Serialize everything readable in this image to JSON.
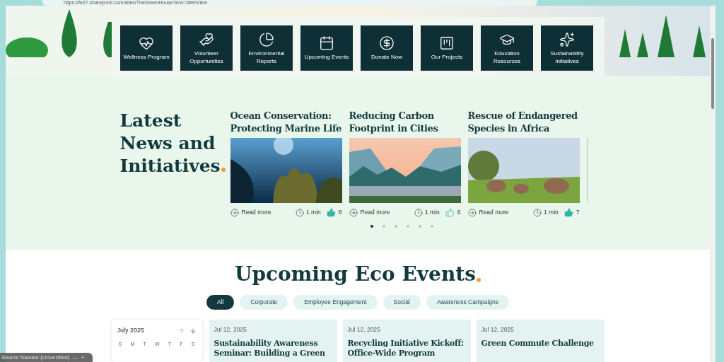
{
  "browser": {
    "url": "https://fe27.sharepoint.com/sites/TheGreenHouse?env=WebView"
  },
  "quick_links": [
    {
      "label": "Wellness Program"
    },
    {
      "label": "Volunteer Opportunities"
    },
    {
      "label": "Environmental Reports"
    },
    {
      "label": "Upcoming Events"
    },
    {
      "label": "Donate Now"
    },
    {
      "label": "Our Projects"
    },
    {
      "label": "Education Resources"
    },
    {
      "label": "Sustainability Initiatives"
    }
  ],
  "news": {
    "title": "Latest News and Initiatives",
    "articles": [
      {
        "title": "Ocean Conservation: Protecting Marine Life",
        "read_more": "Read more",
        "time": "1 min",
        "likes": "8",
        "liked": true
      },
      {
        "title": "Reducing Carbon Footprint in Cities",
        "read_more": "Read more",
        "time": "1 min",
        "likes": "6",
        "liked": false
      },
      {
        "title": "Rescue of Endangered Species in Africa",
        "read_more": "Read more",
        "time": "1 min",
        "likes": "7",
        "liked": true
      }
    ],
    "pages": [
      {
        "selected": true
      },
      {
        "selected": false
      },
      {
        "selected": false
      },
      {
        "selected": false
      },
      {
        "selected": false
      },
      {
        "selected": false
      }
    ]
  },
  "events": {
    "title": "Upcoming Eco Events",
    "filters": [
      {
        "label": "All",
        "selected": true
      },
      {
        "label": "Corporate",
        "selected": false
      },
      {
        "label": "Employee Engagement",
        "selected": false
      },
      {
        "label": "Social",
        "selected": false
      },
      {
        "label": "Awareness Campaigns",
        "selected": false
      }
    ],
    "calendar": {
      "month": "July 2025",
      "weekdays": [
        "S",
        "M",
        "T",
        "W",
        "T",
        "F",
        "S"
      ]
    },
    "cards": [
      {
        "date": "Jul 12, 2025",
        "title": "Sustainability Awareness Seminar: Building a Green"
      },
      {
        "date": "Jul 12, 2025",
        "title": "Recycling Initiative Kickoff: Office-Wide Program"
      },
      {
        "date": "Jul 12, 2025",
        "title": "Green Commute Challenge"
      }
    ]
  },
  "presence": {
    "name": "Swami Nawale (Unverified)",
    "minus": "—",
    "plus": "+"
  }
}
